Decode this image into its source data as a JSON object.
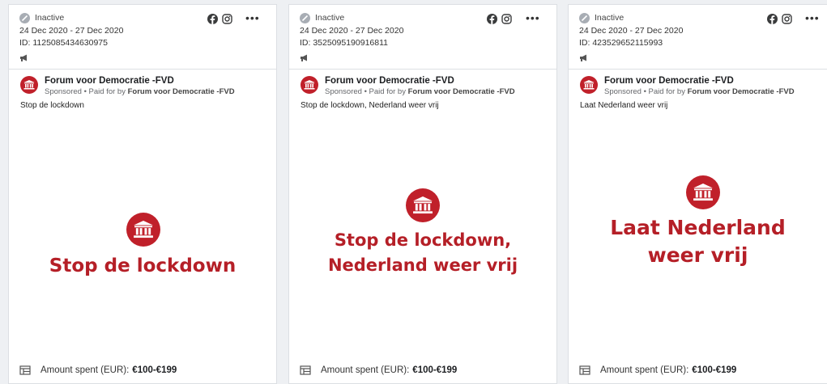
{
  "brand_color": "#c0202a",
  "cards": [
    {
      "status": "Inactive",
      "dates": "24 Dec 2020 - 27 Dec 2020",
      "id_text": "ID: 1125085434630975",
      "platform_icons": [
        "facebook-icon",
        "instagram-icon"
      ],
      "menu_icon": "more-icon",
      "page_name": "Forum voor Democratie -FVD",
      "sponsored_prefix": "Sponsored • Paid for by",
      "sponsored_by": "Forum voor Democratie -FVD",
      "ad_text": "Stop de lockdown",
      "slogan_lines": [
        "Stop de lockdown"
      ],
      "spend_label": "Amount spent (EUR):",
      "spend_value": "€100-€199"
    },
    {
      "status": "Inactive",
      "dates": "24 Dec 2020 - 27 Dec 2020",
      "id_text": "ID: 3525095190916811",
      "platform_icons": [
        "facebook-icon",
        "instagram-icon"
      ],
      "menu_icon": "more-icon",
      "page_name": "Forum voor Democratie -FVD",
      "sponsored_prefix": "Sponsored • Paid for by",
      "sponsored_by": "Forum voor Democratie -FVD",
      "ad_text": "Stop de lockdown, Nederland weer vrij",
      "slogan_lines": [
        "Stop de lockdown,",
        "Nederland weer vrij"
      ],
      "spend_label": "Amount spent (EUR):",
      "spend_value": "€100-€199"
    },
    {
      "status": "Inactive",
      "dates": "24 Dec 2020 - 27 Dec 2020",
      "id_text": "ID: 423529652115993",
      "platform_icons": [
        "facebook-icon",
        "instagram-icon"
      ],
      "menu_icon": "more-icon",
      "page_name": "Forum voor Democratie -FVD",
      "sponsored_prefix": "Sponsored • Paid for by",
      "sponsored_by": "Forum voor Democratie -FVD",
      "ad_text": "Laat Nederland weer vrij",
      "slogan_lines": [
        "Laat Nederland",
        "weer vrij"
      ],
      "spend_label": "Amount spent (EUR):",
      "spend_value": "€100-€199"
    }
  ]
}
